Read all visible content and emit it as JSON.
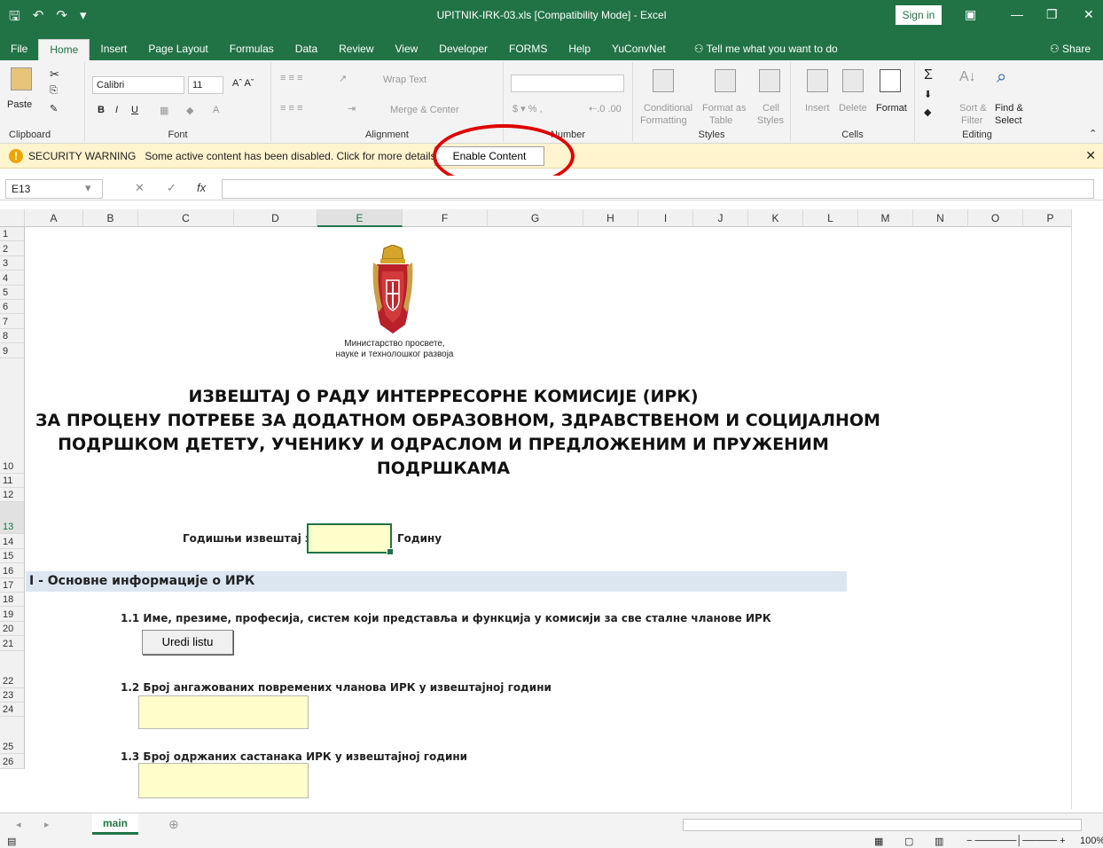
{
  "window": {
    "title": "UPITNIK-IRK-03.xls  [Compatibility Mode]  -  Excel",
    "signin_label": "Sign in"
  },
  "tabs": [
    "File",
    "Home",
    "Insert",
    "Page Layout",
    "Formulas",
    "Data",
    "Review",
    "View",
    "Developer",
    "FORMS",
    "Help",
    "YuConvNet"
  ],
  "tell_me": "Tell me what you want to do",
  "share": "Share",
  "ribbon": {
    "clipboard": {
      "label": "Clipboard",
      "paste": "Paste"
    },
    "font": {
      "label": "Font",
      "name": "Calibri",
      "size": "11"
    },
    "alignment": {
      "label": "Alignment",
      "wrap": "Wrap Text",
      "merge": "Merge & Center"
    },
    "number": {
      "label": "Number"
    },
    "styles": {
      "label": "Styles",
      "conditional": "Conditional",
      "formatting": "Formatting",
      "format_as": "Format as",
      "table": "Table",
      "cell": "Cell",
      "styles_btn": "Styles"
    },
    "cells": {
      "label": "Cells",
      "insert": "Insert",
      "delete": "Delete",
      "format": "Format"
    },
    "editing": {
      "label": "Editing",
      "sort": "Sort &",
      "filter": "Filter",
      "find": "Find &",
      "select": "Select"
    }
  },
  "security": {
    "title": "SECURITY WARNING",
    "message": "Some active content has been disabled. Click for more details.",
    "button": "Enable Content"
  },
  "formula_bar": {
    "name_box": "E13",
    "fx": "fx",
    "value": ""
  },
  "columns": [
    "A",
    "B",
    "C",
    "D",
    "E",
    "F",
    "G",
    "H",
    "I",
    "J",
    "K",
    "L",
    "M",
    "N",
    "O",
    "P"
  ],
  "rows": [
    "1",
    "2",
    "3",
    "4",
    "5",
    "6",
    "7",
    "8",
    "9",
    "10",
    "11",
    "12",
    "13",
    "14",
    "15",
    "16",
    "17",
    "18",
    "19",
    "20",
    "21",
    "22",
    "23",
    "24",
    "25",
    "26"
  ],
  "selected_column": "E",
  "selected_row": "13",
  "sheet": {
    "ministry_line1": "Министарство просвете,",
    "ministry_line2": "науке и технолошког развоја",
    "title_lines": [
      "ИЗВЕШТАЈ О РАДУ ИНТЕРРЕСОРНЕ КОМИСИЈЕ (ИРК)",
      "ЗА ПРОЦЕНУ ПОТРЕБЕ ЗА ДОДАТНОМ ОБРАЗОВНОМ, ЗДРАВСТВЕНОМ И СОЦИЈАЛНОМ",
      "ПОДРШКОМ ДЕТЕТУ, УЧЕНИКУ И ОДРАСЛОМ И ПРЕДЛОЖЕНИМ И ПРУЖЕНИМ",
      "ПОДРШКАМА"
    ],
    "annual_label": "Годишњи извештај за",
    "year_label": "Годину",
    "section1": "I - Основне информације о ИРК",
    "q11": "1.1 Име, презиме, професија, систем који представља и функција у комисији за све сталне чланове ИРК",
    "edit_list": "Uredi listu",
    "q12": "1.2 Број ангажованих повремених чланова ИРК у извештајној години",
    "q13": "1.3 Број одржаних састанака ИРК у извештајној години"
  },
  "sheet_tab": "main",
  "zoom": "100%"
}
